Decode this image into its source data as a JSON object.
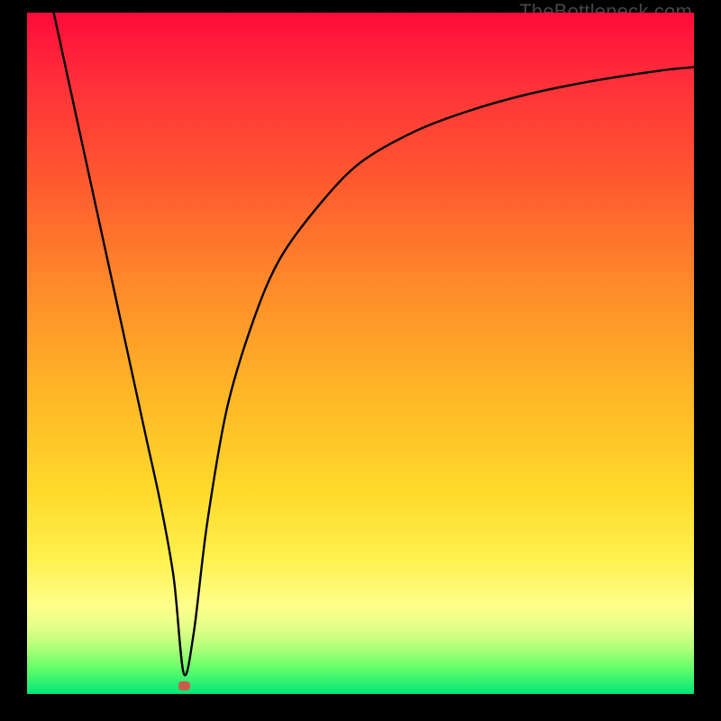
{
  "watermark": "TheBottleneck.com",
  "chart_data": {
    "type": "line",
    "title": "",
    "xlabel": "",
    "ylabel": "",
    "xlim": [
      0,
      100
    ],
    "ylim": [
      0,
      100
    ],
    "grid": false,
    "legend": false,
    "annotations": [],
    "series": [
      {
        "name": "bottleneck-curve",
        "x": [
          4,
          6,
          8,
          10,
          12,
          14,
          16,
          18,
          20,
          22,
          23.5,
          25,
          27,
          30,
          34,
          38,
          44,
          50,
          58,
          66,
          75,
          85,
          95,
          100
        ],
        "y": [
          100,
          91,
          82,
          73,
          64,
          55,
          46,
          37,
          28,
          17,
          3,
          9,
          25,
          42,
          55,
          64,
          72,
          78,
          82.5,
          85.5,
          88,
          90,
          91.5,
          92
        ]
      }
    ],
    "marker": {
      "x": 23.5,
      "y": 1.2,
      "color": "#cc5a4a"
    },
    "background_gradient": {
      "type": "linear-vertical",
      "stops": [
        {
          "pos": 0,
          "color": "#ff0b3a"
        },
        {
          "pos": 10,
          "color": "#ff2f3a"
        },
        {
          "pos": 25,
          "color": "#ff5a2f"
        },
        {
          "pos": 40,
          "color": "#ff8a2a"
        },
        {
          "pos": 55,
          "color": "#ffb427"
        },
        {
          "pos": 70,
          "color": "#ffd92a"
        },
        {
          "pos": 80,
          "color": "#fff04d"
        },
        {
          "pos": 87,
          "color": "#ffff8a"
        },
        {
          "pos": 90,
          "color": "#e6ff8a"
        },
        {
          "pos": 93,
          "color": "#b5ff7a"
        },
        {
          "pos": 96,
          "color": "#6bff6b"
        },
        {
          "pos": 100,
          "color": "#00e676"
        }
      ]
    }
  }
}
